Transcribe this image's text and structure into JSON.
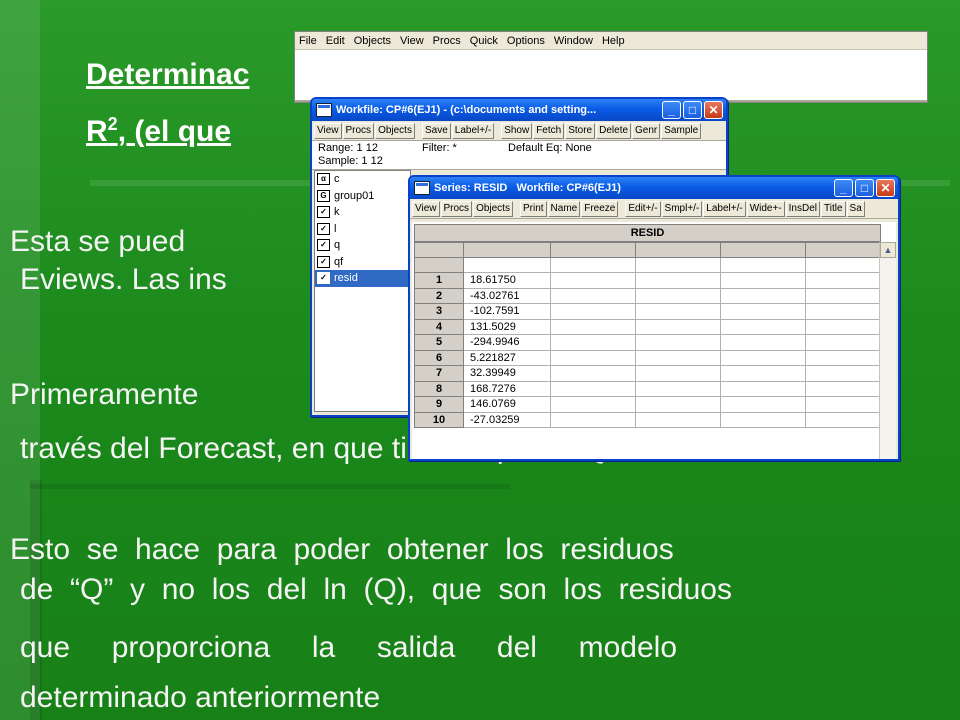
{
  "slide": {
    "title_line1": "Determinac",
    "title_line2": "R",
    "title_sup": "2",
    "title_line2_rest": ", (el que",
    "para1_line1": "Esta  se  pued",
    "para1_line2": "Eviews. Las ins",
    "para2_line1": "Primeramente",
    "para2_line2": "través del Forecast, en que tiene implícito Q/Y",
    "para3_line1": "Esto  se  hace  para  poder  obtener  los  residuos",
    "para3_line2": "de  “Q”  y  no  los  del  ln  (Q),  que  son  los  residuos",
    "para3_line3": "que     proporciona     la     salida     del     modelo",
    "para3_line4": "determinado anteriormente"
  },
  "app": {
    "menu": [
      "File",
      "Edit",
      "Objects",
      "View",
      "Procs",
      "Quick",
      "Options",
      "Window",
      "Help"
    ]
  },
  "workfile": {
    "title": "Workfile: CP#6(EJ1) - (c:\\documents and setting...",
    "toolbar": [
      "View",
      "Procs",
      "Objects",
      "Save",
      "Label+/-",
      "Show",
      "Fetch",
      "Store",
      "Delete",
      "Genr",
      "Sample"
    ],
    "range_label": "Range:  1 12",
    "filter_label": "Filter: *",
    "default_eq": "Default Eq: None",
    "sample_label": "Sample: 1 12",
    "objects": [
      {
        "name": "c",
        "icon": "α",
        "selected": false
      },
      {
        "name": "group01",
        "icon": "G",
        "selected": false
      },
      {
        "name": "k",
        "icon": "✓",
        "selected": false
      },
      {
        "name": "l",
        "icon": "✓",
        "selected": false
      },
      {
        "name": "q",
        "icon": "✓",
        "selected": false
      },
      {
        "name": "qf",
        "icon": "✓",
        "selected": false
      },
      {
        "name": "resid",
        "icon": "✓",
        "selected": true
      }
    ]
  },
  "series": {
    "title": "Series: RESID   Workfile: CP#6(EJ1)",
    "toolbar": [
      "View",
      "Procs",
      "Objects",
      "Print",
      "Name",
      "Freeze",
      "Edit+/-",
      "Smpl+/-",
      "Label+/-",
      "Wide+-",
      "InsDel",
      "Title",
      "Sa"
    ],
    "header": "RESID",
    "rows": [
      {
        "obs": "1",
        "value": "18.61750"
      },
      {
        "obs": "2",
        "value": "-43.02761"
      },
      {
        "obs": "3",
        "value": "-102.7591"
      },
      {
        "obs": "4",
        "value": "131.5029"
      },
      {
        "obs": "5",
        "value": "-294.9946"
      },
      {
        "obs": "6",
        "value": "5.221827"
      },
      {
        "obs": "7",
        "value": "32.39949"
      },
      {
        "obs": "8",
        "value": "168.7276"
      },
      {
        "obs": "9",
        "value": "146.0769"
      },
      {
        "obs": "10",
        "value": "-27.03259"
      }
    ]
  },
  "colors": {
    "slide_green": "#1f8a1f",
    "titlebar_blue": "#0a5ce6",
    "selection_blue": "#316ac5"
  }
}
